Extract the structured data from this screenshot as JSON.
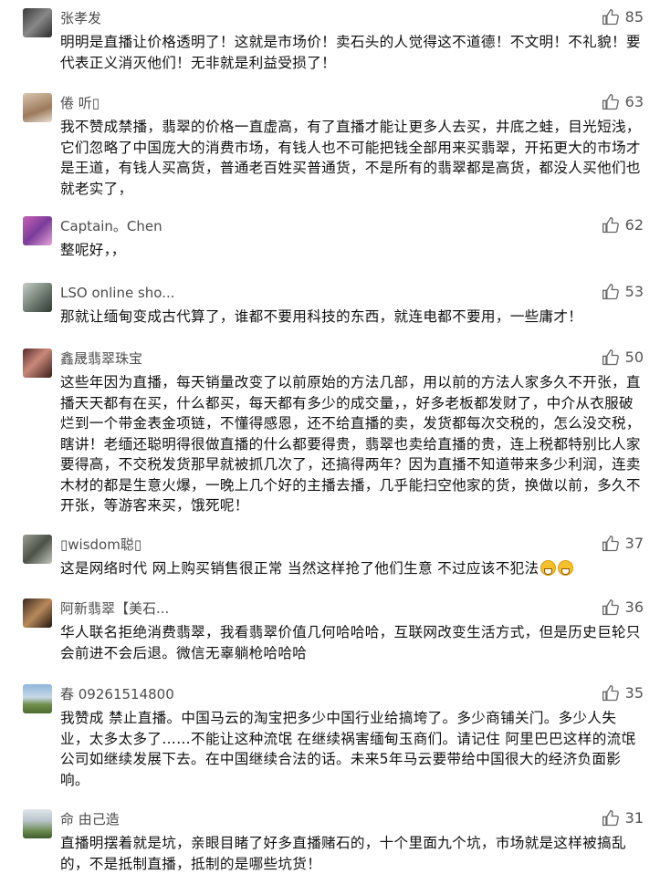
{
  "comments": [
    {
      "name": "张孝发",
      "likes": "85",
      "text": "明明是直播让价格透明了！这就是市场价！卖石头的人觉得这不道德！不文明！不礼貌！要代表正义消灭他们！无非就是利益受损了！"
    },
    {
      "name": "倦 听▯",
      "likes": "63",
      "text": "我不赞成禁播，翡翠的价格一直虚高，有了直播才能让更多人去买，井底之蛙，目光短浅，它们忽略了中国庞大的消费市场，有钱人也不可能把钱全部用来买翡翠，开拓更大的市场才是王道，有钱人买高货，普通老百姓买普通货，不是所有的翡翠都是高货，都没人买他们也就老实了，"
    },
    {
      "name": "Captain。Chen",
      "likes": "62",
      "text": "整呢好，，"
    },
    {
      "name": "LSO online sho...",
      "likes": "53",
      "text": "那就让缅甸变成古代算了，谁都不要用科技的东西，就连电都不要用，一些庸才！"
    },
    {
      "name": "鑫晟翡翠珠宝",
      "likes": "50",
      "text": "这些年因为直播，每天销量改变了以前原始的方法几部，用以前的方法人家多久不开张，直播天天都有在买，什么都买，每天都有多少的成交量，，好多老板都发财了，中介从衣服破烂到一个带金表金项链，不懂得感恩，还不给直播的卖，发货都每次交税的，怎么没交税，瞎讲！老缅还聪明得很做直播的什么都要得贵，翡翠也卖给直播的贵，连上税都特别比人家要得高，不交税发货那早就被抓几次了，还搞得两年？因为直播不知道带来多少利润，连卖木材的都是生意火爆，一晚上几个好的主播去播，几乎能扫空他家的货，换做以前，多久不开张，等游客来买，饿死呢！"
    },
    {
      "name": "▯wisdom聪▯",
      "likes": "37",
      "text": "这是网络时代 网上购买销售很正常 当然这样抢了他们生意  不过应该不犯法",
      "emoji_count": 2
    },
    {
      "name": "阿新翡翠【美石...",
      "likes": "36",
      "text": "华人联名拒绝消费翡翠，我看翡翠价值几何哈哈哈，互联网改变生活方式，但是历史巨轮只会前进不会后退。微信无辜躺枪哈哈哈"
    },
    {
      "name": "春 09261514800",
      "likes": "35",
      "text": "我赞成 禁止直播。中国马云的淘宝把多少中国行业给搞垮了。多少商铺关门。多少人失业，太多太多了……不能让这种流氓 在继续祸害缅甸玉商们。请记住 阿里巴巴这样的流氓公司如继续发展下去。在中国继续合法的话。未来5年马云要带给中国很大的经济负面影响。"
    },
    {
      "name": "命 由己造",
      "likes": "31",
      "text": "直播明摆着就是坑，亲眼目睹了好多直播赌石的，十个里面九个坑，市场就是这样被搞乱的，不是抵制直播，抵制的是哪些坑货！"
    }
  ]
}
